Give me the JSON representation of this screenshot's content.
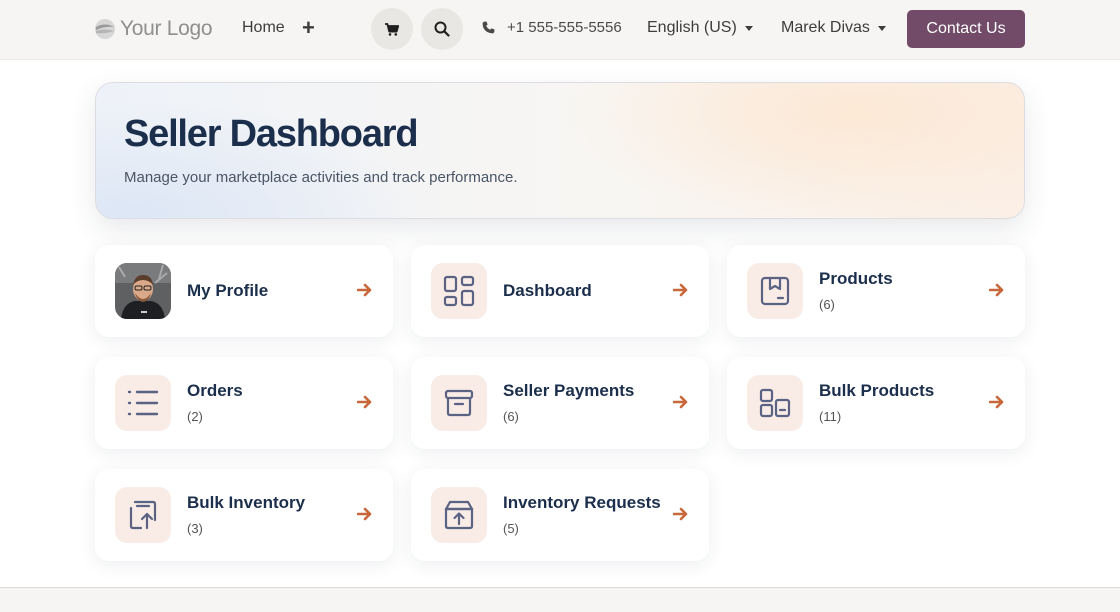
{
  "navbar": {
    "logo_text": "Your Logo",
    "home_label": "Home",
    "plus_label": "+",
    "cart_icon": "cart-icon",
    "search_icon": "search-icon",
    "phone_icon": "phone-icon",
    "phone": "+1 555-555-5556",
    "language": "English (US)",
    "user": "Marek Divas",
    "contact_label": "Contact Us"
  },
  "hero": {
    "title": "Seller Dashboard",
    "subtitle": "Manage your marketplace activities and track performance."
  },
  "cards": [
    {
      "title": "My Profile",
      "count": "",
      "icon": "avatar"
    },
    {
      "title": "Dashboard",
      "count": "",
      "icon": "dashboard-icon"
    },
    {
      "title": "Products",
      "count": "(6)",
      "icon": "box-icon"
    },
    {
      "title": "Orders",
      "count": "(2)",
      "icon": "list-icon"
    },
    {
      "title": "Seller Payments",
      "count": "(6)",
      "icon": "archive-icon"
    },
    {
      "title": "Bulk Products",
      "count": "(11)",
      "icon": "bulk-icon"
    },
    {
      "title": "Bulk Inventory",
      "count": "(3)",
      "icon": "upload-icon"
    },
    {
      "title": "Inventory Requests",
      "count": "(5)",
      "icon": "box-upload-icon"
    }
  ],
  "colors": {
    "brand": "#714b67",
    "accent_arrow": "#c8683a",
    "heading": "#1b2e4b",
    "icon_tile": "#f9ebe6",
    "icon_stroke": "#5a6384"
  }
}
